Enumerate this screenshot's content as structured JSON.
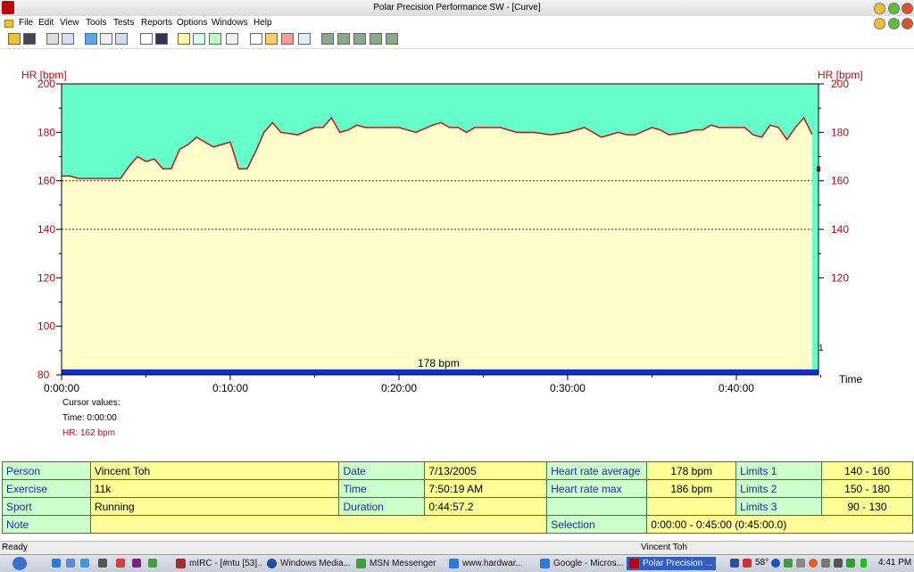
{
  "window": {
    "title": "Polar Precision Performance SW - [Curve]"
  },
  "menu": [
    "File",
    "Edit",
    "View",
    "Tools",
    "Tests",
    "Reports",
    "Options",
    "Windows",
    "Help"
  ],
  "chart": {
    "left_axis_label": "HR [bpm]",
    "right_axis_label": "HR [bpm]",
    "y_ticks": [
      "200",
      "180",
      "160",
      "140",
      "120",
      "100",
      "80"
    ],
    "right_y_ticks": [
      "200",
      "180",
      "160",
      "140",
      "120"
    ],
    "x_ticks": [
      "0:00:00",
      "0:10:00",
      "0:20:00",
      "0:30:00",
      "0:40:00"
    ],
    "x_axis_label": "Time",
    "avg_label": "178 bpm",
    "right_marker": "1"
  },
  "chart_data": {
    "type": "area",
    "xlabel": "Time",
    "ylabel": "HR [bpm]",
    "xlim_minutes": [
      0,
      45
    ],
    "ylim": [
      80,
      200
    ],
    "limit_lines": [
      140,
      160
    ],
    "x_minutes": [
      0,
      0.5,
      1,
      2,
      3,
      3.5,
      4,
      4.5,
      5,
      5.5,
      6,
      6.5,
      7,
      7.5,
      8,
      9,
      10,
      10.5,
      11,
      11.5,
      12,
      12.5,
      13,
      14,
      15,
      15.5,
      16,
      16.5,
      17,
      17.5,
      18,
      19,
      20,
      21,
      22,
      22.5,
      23,
      23.5,
      24,
      24.5,
      25,
      26,
      27,
      28,
      29,
      30,
      30.5,
      31,
      32,
      33,
      33.5,
      34,
      35,
      35.5,
      36,
      37,
      37.5,
      38,
      38.5,
      39,
      40,
      40.5,
      41,
      41.5,
      42,
      42.5,
      43,
      43.5,
      44,
      44.5
    ],
    "heart_rate_bpm": [
      162,
      162,
      161,
      161,
      161,
      161,
      166,
      170,
      168,
      169,
      165,
      165,
      173,
      175,
      178,
      174,
      176,
      165,
      165,
      172,
      180,
      184,
      180,
      179,
      182,
      182,
      186,
      180,
      181,
      183,
      182,
      182,
      182,
      180,
      183,
      184,
      182,
      182,
      180,
      182,
      182,
      182,
      180,
      180,
      179,
      180,
      181,
      182,
      178,
      180,
      179,
      179,
      182,
      181,
      179,
      180,
      181,
      181,
      183,
      182,
      182,
      182,
      179,
      178,
      183,
      182,
      177,
      182,
      186,
      179
    ]
  },
  "cursor": {
    "title": "Cursor values:",
    "time": "Time: 0:00:00",
    "hr": "HR: 162 bpm"
  },
  "info": {
    "person_label": "Person",
    "person": "Vincent Toh",
    "date_label": "Date",
    "date": "7/13/2005",
    "hr_avg_label": "Heart rate average",
    "hr_avg": "178 bpm",
    "limits1_label": "Limits 1",
    "limits1": "140 - 160",
    "exercise_label": "Exercise",
    "exercise": "11k",
    "time_label": "Time",
    "time": "7:50:19 AM",
    "hr_max_label": "Heart rate max",
    "hr_max": "186 bpm",
    "limits2_label": "Limits 2",
    "limits2": "150 - 180",
    "sport_label": "Sport",
    "sport": "Running",
    "duration_label": "Duration",
    "duration": "0:44:57.2",
    "limits3_label": "Limits 3",
    "limits3": "90 - 130",
    "note_label": "Note",
    "selection_label": "Selection",
    "selection": "0:00:00 - 0:45:00 (0:45:00.0)"
  },
  "status": {
    "left": "Ready",
    "right": "Vincent Toh"
  },
  "taskbar": {
    "tasks": [
      "mIRC - [#ntu [53]...",
      "Windows Media...",
      "MSN Messenger",
      "www.hardwar...",
      "Google - Micros...",
      "Polar Precision ..."
    ],
    "temp": "58°",
    "clock": "4:41 PM"
  },
  "colors": {
    "above_limit": "#66ffcc",
    "below_limit": "#ffffcc",
    "curve": "#cc1010",
    "avg_bar": "#1030cc",
    "axis_label": "#b01010"
  }
}
